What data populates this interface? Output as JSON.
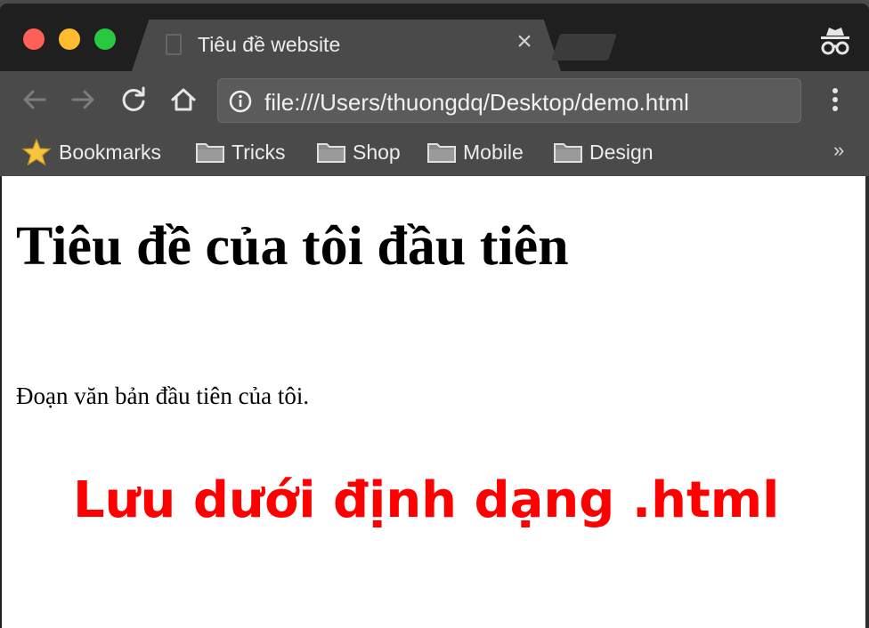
{
  "window": {
    "tab": {
      "title": "Tiêu đề website",
      "close_glyph": "×"
    }
  },
  "toolbar": {
    "url": "file:///Users/thuongdq/Desktop/demo.html",
    "icons": [
      "back-arrow-icon",
      "forward-arrow-icon",
      "reload-icon",
      "home-icon",
      "info-icon",
      "kebab-menu-icon"
    ]
  },
  "bookmarks": {
    "items": [
      {
        "label": "Bookmarks",
        "icon": "star-icon"
      },
      {
        "label": "Tricks",
        "icon": "folder-icon"
      },
      {
        "label": "Shop",
        "icon": "folder-icon"
      },
      {
        "label": "Mobile",
        "icon": "folder-icon"
      },
      {
        "label": "Design",
        "icon": "folder-icon"
      }
    ],
    "overflow": "»"
  },
  "page": {
    "heading": "Tiêu đề của tôi đầu tiên",
    "paragraph": "Đoạn văn bản đầu tiên của tôi.",
    "caption": "Lưu dưới định dạng .html"
  },
  "colors": {
    "traffic_close": "#fe5f57",
    "traffic_min": "#febc2e",
    "traffic_max": "#28c840",
    "chrome_dark": "#1f1f1f",
    "chrome_tab": "#4a4a4a",
    "caption": "#ff0000"
  }
}
